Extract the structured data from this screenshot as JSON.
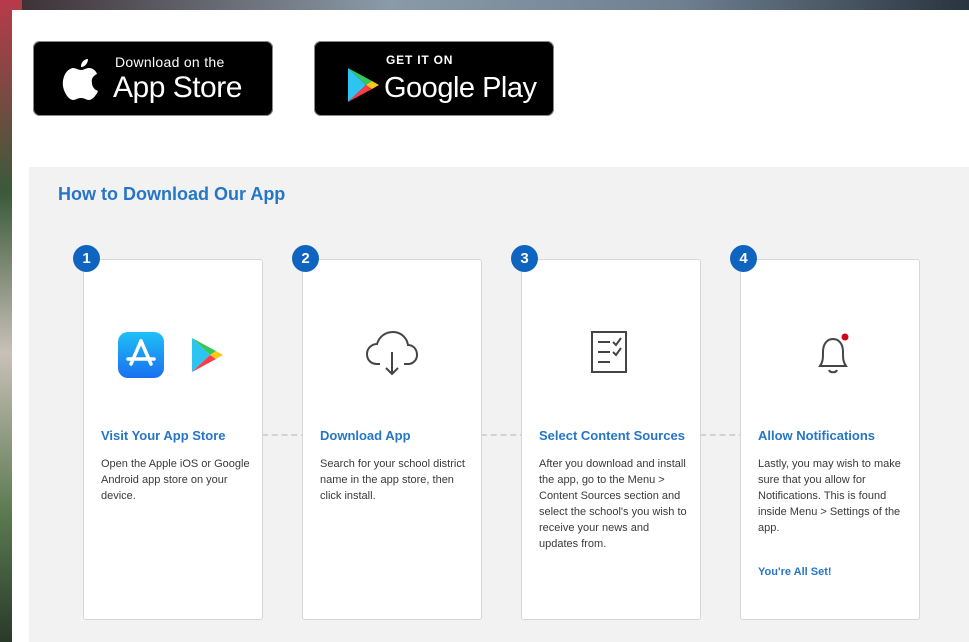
{
  "stores": {
    "apple": {
      "small": "Download on the",
      "big": "App Store",
      "icon": "apple-logo-icon"
    },
    "google": {
      "small": "GET IT ON",
      "big": "Google Play",
      "icon": "google-play-logo-icon"
    }
  },
  "howto": {
    "title": "How to Download Our App",
    "steps": [
      {
        "number": "1",
        "title": "Visit Your App Store",
        "body": "Open the Apple iOS or Google Android app store on your device.",
        "icons": [
          "app-store-icon",
          "google-play-icon"
        ]
      },
      {
        "number": "2",
        "title": "Download App",
        "body": "Search for your school district name in the app store, then click install.",
        "icons": [
          "cloud-download-icon"
        ]
      },
      {
        "number": "3",
        "title": "Select Content Sources",
        "body": "After you download and install the app, go to the Menu > Content Sources section and select the school's you wish to receive your news and updates from.",
        "icons": [
          "checklist-icon"
        ]
      },
      {
        "number": "4",
        "title": "Allow Notifications",
        "body": "Lastly, you may wish to make sure that you allow for Notifications. This is found inside Menu > Settings of the app.",
        "footer": "You're All Set!",
        "icons": [
          "notification-bell-icon"
        ]
      }
    ]
  },
  "colors": {
    "accent": "#2676c7",
    "badge": "#0f64c0",
    "section_bg": "#f2f2f2",
    "notification_dot": "#d0021b"
  }
}
